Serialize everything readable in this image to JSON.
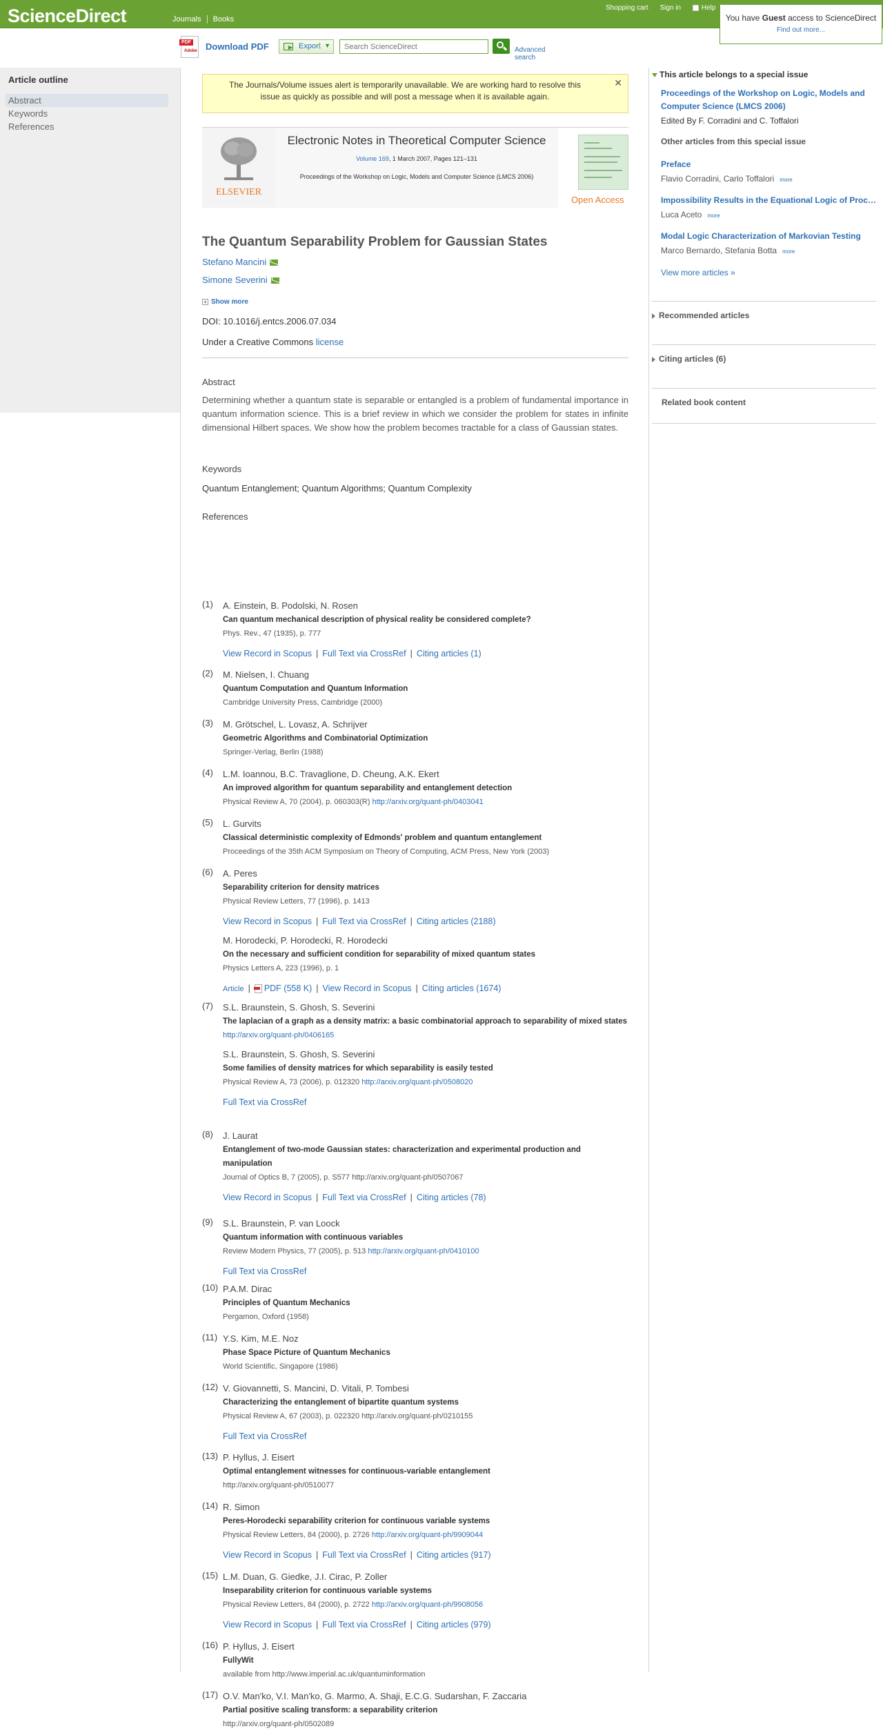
{
  "header": {
    "brand": "ScienceDirect",
    "nav": [
      "Journals",
      "Books"
    ],
    "links": {
      "cart": "Shopping cart",
      "sign_in": "Sign in",
      "help": "Help"
    },
    "guest": {
      "prefix": "You have",
      "bold": "Guest",
      "suffix": "access to ScienceDirect",
      "find_out": "Find out more..."
    }
  },
  "toolbar": {
    "download_pdf": "Download PDF",
    "export": "Export",
    "search_placeholder": "Search ScienceDirect",
    "advanced": "Advanced search"
  },
  "outline": {
    "title": "Article outline",
    "items": [
      "Abstract",
      "Keywords",
      "References"
    ]
  },
  "alert": {
    "text": "The Journals/Volume issues alert is temporarily unavailable. We are working hard to resolve this issue as quickly as possible and will post a message when it is available again."
  },
  "journal": {
    "publisher": "ELSEVIER",
    "title": "Electronic Notes in Theoretical Computer Science",
    "volume_link": "Volume 169",
    "volume_rest": ", 1 March 2007, Pages 121–131",
    "proceedings": "Proceedings of the Workshop on Logic, Models and Computer Science (LMCS 2006)",
    "open_access": "Open Access"
  },
  "article": {
    "title": "The Quantum Separability Problem for Gaussian States",
    "authors": [
      "Stefano Mancini",
      "Simone Severini"
    ],
    "show_more": "Show more",
    "doi_label": "DOI:",
    "doi": "10.1016/j.entcs.2006.07.034",
    "license_prefix": "Under a Creative Commons",
    "license_link": "license"
  },
  "abstract": {
    "heading": "Abstract",
    "text": "Determining whether a quantum state is separable or entangled is a problem of fundamental importance in quantum information science. This is a brief review in which we consider the problem for states in infinite dimensional Hilbert spaces. We show how the problem becomes tractable for a class of Gaussian states."
  },
  "keywords": {
    "heading": "Keywords",
    "text": "Quantum Entanglement; Quantum Algorithms; Quantum Complexity"
  },
  "references": {
    "heading": "References",
    "items": [
      {
        "num": "(1)",
        "entries": [
          {
            "authors": "A. Einstein, B. Podolski, N. Rosen",
            "title": "Can quantum mechanical description of physical reality be considered complete?",
            "source": "Phys. Rev., 47 (1935), p. 777",
            "links": [
              "View Record in Scopus",
              "Full Text via CrossRef",
              "Citing articles (1)"
            ]
          }
        ]
      },
      {
        "num": "(2)",
        "entries": [
          {
            "authors": "M. Nielsen, I. Chuang",
            "title": "Quantum Computation and Quantum Information",
            "source": "Cambridge University Press, Cambridge (2000)"
          }
        ]
      },
      {
        "num": "(3)",
        "entries": [
          {
            "authors": "M. Grötschel, L. Lovasz, A. Schrijver",
            "title": "Geometric Algorithms and Combinatorial Optimization",
            "source": "Springer-Verlag, Berlin (1988)"
          }
        ]
      },
      {
        "num": "(4)",
        "entries": [
          {
            "authors": "L.M. Ioannou, B.C. Travaglione, D. Cheung, A.K. Ekert",
            "title": "An improved algorithm for quantum separability and entanglement detection",
            "source": "Physical Review A, 70 (2004), p. 060303(R)",
            "source_link": "http://arxiv.org/quant-ph/0403041"
          }
        ]
      },
      {
        "num": "(5)",
        "entries": [
          {
            "authors": "L. Gurvits",
            "title": "Classical deterministic complexity of Edmonds' problem and quantum entanglement",
            "source": "Proceedings of the 35th ACM Symposium on Theory of Computing, ACM Press, New York (2003)"
          }
        ]
      },
      {
        "num": "(6)",
        "entries": [
          {
            "authors": "A. Peres",
            "title": "Separability criterion for density matrices",
            "source": "Physical Review Letters, 77 (1996), p. 1413",
            "links": [
              "View Record in Scopus",
              "Full Text via CrossRef",
              "Citing articles (2188)"
            ]
          },
          {
            "authors": "M. Horodecki, P. Horodecki, R. Horodecki",
            "title": "On the necessary and sufficient condition for separability of mixed quantum states",
            "source": "Physics Letters A, 223 (1996), p. 1",
            "links": [
              "Article",
              "PDF (558 K)",
              "View Record in Scopus",
              "Citing articles (1674)"
            ]
          }
        ]
      },
      {
        "num": "(7)",
        "entries": [
          {
            "authors": "S.L. Braunstein, S. Ghosh, S. Severini",
            "title": "The laplacian of a graph as a density matrix: a basic combinatorial approach to separability of mixed states",
            "source": "",
            "source_link": "http://arxiv.org/quant-ph/0406165"
          },
          {
            "authors": "S.L. Braunstein, S. Ghosh, S. Severini",
            "title": "Some families of density matrices for which separability is easily tested",
            "source": "Physical Review A, 73 (2006), p. 012320",
            "source_link": "http://arxiv.org/quant-ph/0508020",
            "links": [
              "Full Text via CrossRef"
            ]
          }
        ]
      },
      {
        "num": "(8)",
        "entries": [
          {
            "authors": "J. Laurat",
            "title": "Entanglement of two-mode Gaussian states: characterization and experimental production and manipulation",
            "source": "Journal of Optics B, 7 (2005), p. S577 http://arxiv.org/quant-ph/0507067",
            "links": [
              "View Record in Scopus",
              "Full Text via CrossRef",
              "Citing articles (78)"
            ]
          }
        ]
      },
      {
        "num": "(9)",
        "entries": [
          {
            "authors": "S.L. Braunstein, P. van Loock",
            "title": "Quantum information with continuous variables",
            "source": "Review Modern Physics, 77 (2005), p. 513",
            "source_link": "http://arxiv.org/quant-ph/0410100",
            "links": [
              "Full Text via CrossRef"
            ]
          }
        ]
      },
      {
        "num": "(10)",
        "entries": [
          {
            "authors": "P.A.M. Dirac",
            "title": "Principles of Quantum Mechanics",
            "source": "Pergamon, Oxford (1958)"
          }
        ]
      },
      {
        "num": "(11)",
        "entries": [
          {
            "authors": "Y.S. Kim, M.E. Noz",
            "title": "Phase Space Picture of Quantum Mechanics",
            "source": "World Scientific, Singapore (1986)"
          }
        ]
      },
      {
        "num": "(12)",
        "entries": [
          {
            "authors": "V. Giovannetti, S. Mancini, D. Vitali, P. Tombesi",
            "title": "Characterizing the entanglement of bipartite quantum systems",
            "source": "Physical Review A, 67 (2003), p. 022320 http://arxiv.org/quant-ph/0210155",
            "links": [
              "Full Text via CrossRef"
            ]
          }
        ]
      },
      {
        "num": "(13)",
        "entries": [
          {
            "authors": "P. Hyllus, J. Eisert",
            "title": "Optimal entanglement witnesses for continuous-variable entanglement",
            "source": "http://arxiv.org/quant-ph/0510077"
          }
        ]
      },
      {
        "num": "(14)",
        "entries": [
          {
            "authors": "R. Simon",
            "title": "Peres-Horodecki separability criterion for continuous variable systems",
            "source": "Physical Review Letters, 84 (2000), p. 2726",
            "source_link": "http://arxiv.org/quant-ph/9909044",
            "links": [
              "View Record in Scopus",
              "Full Text via CrossRef",
              "Citing articles (917)"
            ]
          }
        ]
      },
      {
        "num": "(15)",
        "entries": [
          {
            "authors": "L.M. Duan, G. Giedke, J.I. Cirac, P. Zoller",
            "title": "Inseparability criterion for continuous variable systems",
            "source": "Physical Review Letters, 84 (2000), p. 2722",
            "source_link": "http://arxiv.org/quant-ph/9908056",
            "links": [
              "View Record in Scopus",
              "Full Text via CrossRef",
              "Citing articles (979)"
            ]
          }
        ]
      },
      {
        "num": "(16)",
        "entries": [
          {
            "authors": "P. Hyllus, J. Eisert",
            "title": "FullyWit",
            "source": "available from http://www.imperial.ac.uk/quantuminformation"
          }
        ]
      },
      {
        "num": "(17)",
        "entries": [
          {
            "authors": "O.V. Man'ko, V.I. Man'ko, G. Marmo, A. Shaji, E.C.G. Sudarshan, F. Zaccaria",
            "title": "Partial positive scaling transform: a separability criterion",
            "source": "http://arxiv.org/quant-ph/0502089"
          }
        ]
      }
    ]
  },
  "sidebar": {
    "special_heading": "This article belongs to a special issue",
    "proceedings": "Proceedings of the Workshop on Logic, Models and Computer Science (LMCS 2006)",
    "edited_by": "Edited By F. Corradini and C. Toffalori",
    "other_heading": "Other articles from this special issue",
    "other_articles": [
      {
        "title": "Preface",
        "authors": "Flavio Corradini, Carlo Toffalori",
        "more": "more"
      },
      {
        "title": "Impossibility Results in the Equational Logic of Processes",
        "authors": "Luca Aceto",
        "more": "more"
      },
      {
        "title": "Modal Logic Characterization of Markovian Testing",
        "authors": "Marco Bernardo, Stefania Botta",
        "more": "more"
      }
    ],
    "view_more": "View more articles »",
    "recommended": "Recommended articles",
    "citing": "Citing articles (6)",
    "related": "Related book content"
  },
  "colors": {
    "brand_green": "#6aa334",
    "link_blue": "#2e70b5",
    "alert_bg": "#ffffc6",
    "elsevier_orange": "#e87722"
  }
}
